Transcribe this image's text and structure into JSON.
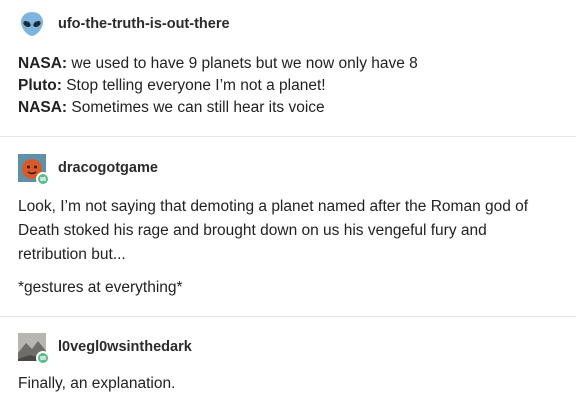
{
  "posts": [
    {
      "username": "ufo-the-truth-is-out-there",
      "avatar_icon": "alien-head-icon",
      "lines": [
        {
          "speaker": "NASA:",
          "text": " we used to have 9 planets but we now only have 8"
        },
        {
          "speaker": "Pluto:",
          "text": " Stop telling everyone I’m not a planet!"
        },
        {
          "speaker": "NASA:",
          "text": " Sometimes we can still hear its voice"
        }
      ]
    },
    {
      "username": "dracogotgame",
      "avatar_icon": "orange-face-avatar-icon",
      "reblog_icon": "reblog-icon",
      "paragraphs": [
        "Look, I’m not saying that demoting a planet named after the Roman god of Death stoked his rage and brought down on us his vengeful fury and retribution but...",
        "*gestures at everything*"
      ]
    },
    {
      "username": "l0vegl0wsinthedark",
      "avatar_icon": "grey-photo-avatar-icon",
      "reblog_icon": "reblog-icon",
      "paragraphs": [
        "Finally, an explanation."
      ]
    }
  ],
  "colors": {
    "reblog_badge": "#56bc8a",
    "divider": "#e6e6e6",
    "alien_blue": "#7fb5dc"
  }
}
